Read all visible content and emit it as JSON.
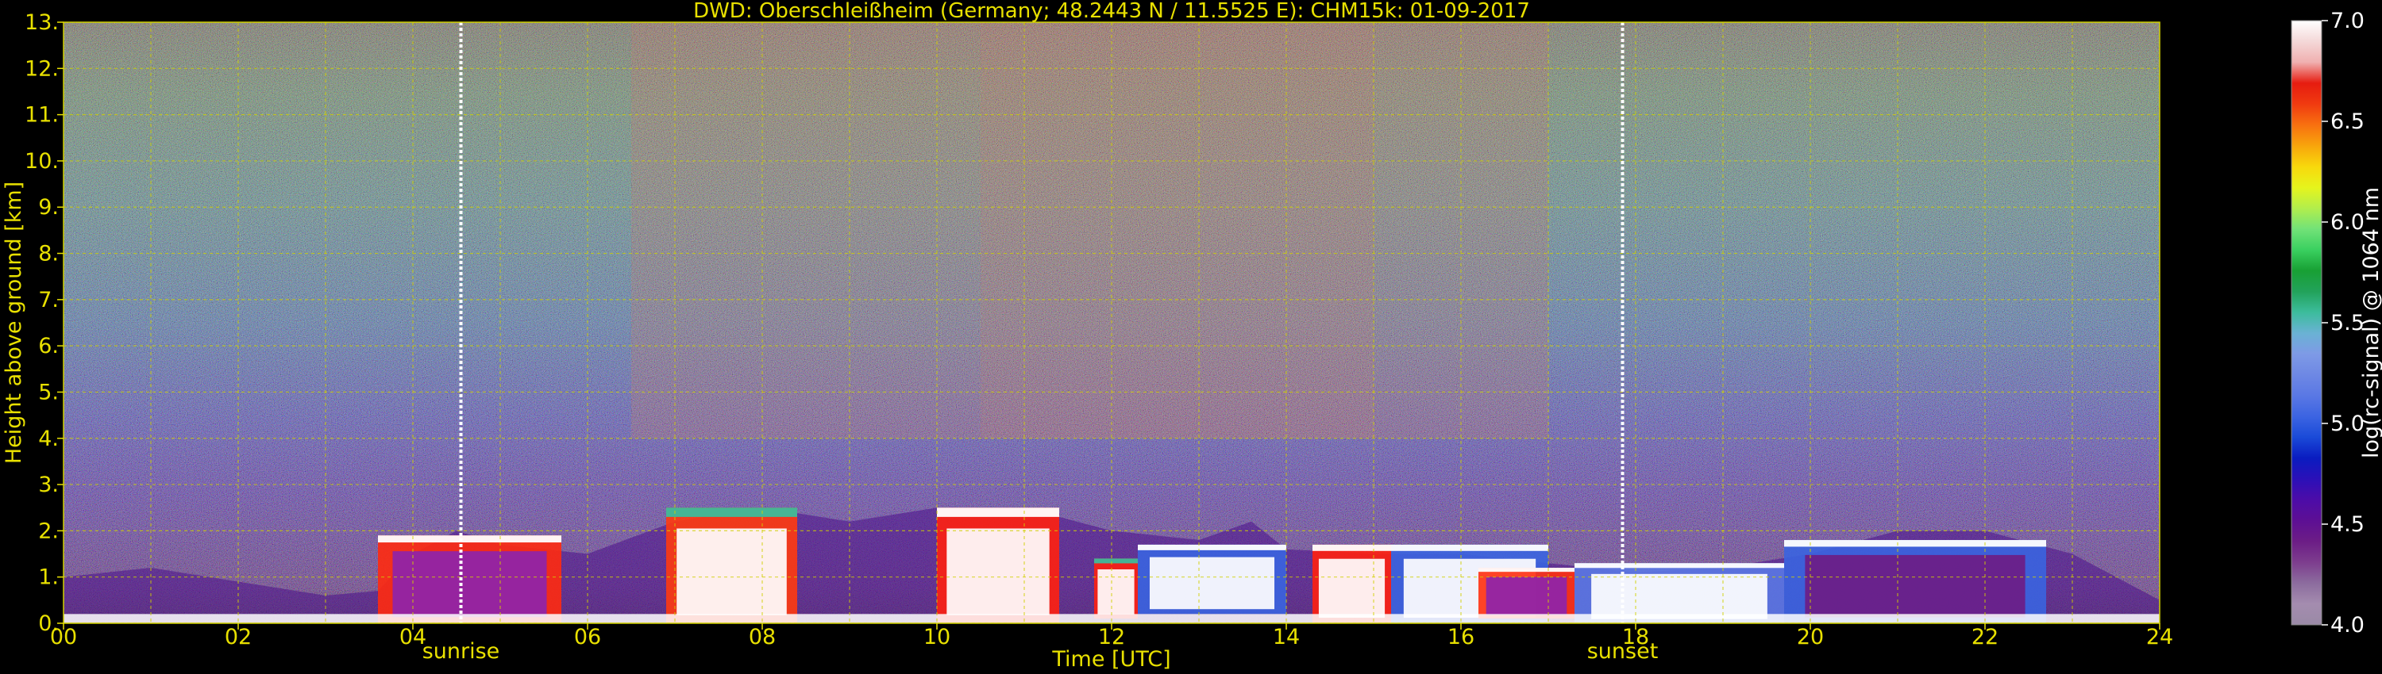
{
  "chart_data": {
    "type": "heatmap",
    "title": "DWD: Oberschleißheim (Germany; 48.2443 N / 11.5525 E):    CHM15k: 01-09-2017",
    "xlabel": "Time [UTC]",
    "ylabel": "Height above ground [km]",
    "xlim": [
      0,
      24
    ],
    "ylim": [
      0,
      13
    ],
    "x_ticks": [
      "00",
      "02",
      "04",
      "06",
      "08",
      "10",
      "12",
      "14",
      "16",
      "18",
      "20",
      "22",
      "24"
    ],
    "y_ticks": [
      "0.",
      "1.",
      "2.",
      "3.",
      "4.",
      "5.",
      "6.",
      "7.",
      "8.",
      "9.",
      "10.",
      "11.",
      "12.",
      "13."
    ],
    "grid": true,
    "colorbar": {
      "label": "log(rc-signal) @ 1064 nm",
      "range": [
        4.0,
        7.0
      ],
      "ticks": [
        "4.0",
        "4.5",
        "5.0",
        "5.5",
        "6.0",
        "6.5",
        "7.0"
      ],
      "colors": [
        "#9a8aa6",
        "#a48caf",
        "#8c6c9e",
        "#7d3d8e",
        "#6c1d86",
        "#5d0f94",
        "#4c0ca8",
        "#2b10b8",
        "#0a1cc0",
        "#1a4ad8",
        "#3c64e2",
        "#5a78e4",
        "#6e88e4",
        "#7e9ae6",
        "#6ab2d4",
        "#3cbc9c",
        "#22a25a",
        "#18a034",
        "#3ad060",
        "#72e278",
        "#b2ee4c",
        "#e6f41c",
        "#f8d80c",
        "#f8a40c",
        "#f87010",
        "#f03a10",
        "#e61c10",
        "#f0b0b0",
        "#f4d8d8",
        "#ffffff"
      ]
    },
    "events": [
      {
        "label": "sunrise",
        "time": 4.55
      },
      {
        "label": "sunset",
        "time": 17.85
      }
    ],
    "colors": {
      "text": "#e8e000",
      "background": "#000000",
      "grid": "#d0d000",
      "event_line": "#ffffff"
    },
    "boundary_layer": [
      [
        0,
        1.0
      ],
      [
        1.0,
        1.2
      ],
      [
        2.0,
        0.9
      ],
      [
        3.0,
        0.6
      ],
      [
        3.6,
        0.7
      ],
      [
        4.0,
        1.5
      ],
      [
        4.5,
        2.0
      ],
      [
        5.0,
        1.7
      ],
      [
        6.0,
        1.5
      ],
      [
        7.0,
        2.2
      ],
      [
        8.0,
        2.5
      ],
      [
        9.0,
        2.2
      ],
      [
        10.0,
        2.5
      ],
      [
        11.0,
        2.5
      ],
      [
        12.0,
        2.0
      ],
      [
        13.0,
        1.8
      ],
      [
        13.6,
        2.2
      ],
      [
        14.0,
        1.6
      ],
      [
        15.0,
        1.5
      ],
      [
        16.0,
        1.5
      ],
      [
        17.0,
        1.3
      ],
      [
        18.0,
        1.1
      ],
      [
        19.0,
        1.2
      ],
      [
        20.0,
        1.5
      ],
      [
        21.0,
        2.0
      ],
      [
        22.0,
        2.0
      ],
      [
        23.0,
        1.5
      ],
      [
        24.0,
        0.5
      ]
    ],
    "aerosol_blocks": [
      {
        "t0": 3.6,
        "t1": 5.7,
        "z0": 0.0,
        "z1": 1.9,
        "core": "#8e24aa",
        "edge": "#ff2a10",
        "top": "#ffffff"
      },
      {
        "t0": 6.9,
        "t1": 8.4,
        "z0": 0.0,
        "z1": 2.5,
        "core": "#ffffff",
        "edge": "#ff3a10",
        "top": "#3cbc9c"
      },
      {
        "t0": 10.0,
        "t1": 11.4,
        "z0": 0.0,
        "z1": 2.5,
        "core": "#ffffff",
        "edge": "#ff2010",
        "top": "#ffffff"
      },
      {
        "t0": 11.8,
        "t1": 12.3,
        "z0": 0.1,
        "z1": 1.4,
        "core": "#ffffff",
        "edge": "#ff2010",
        "top": "#3cbc9c"
      },
      {
        "t0": 12.3,
        "t1": 14.0,
        "z0": 0.2,
        "z1": 1.7,
        "core": "#ffffff",
        "edge": "#3a64e0",
        "top": "#ffffff"
      },
      {
        "t0": 14.3,
        "t1": 15.2,
        "z0": 0.0,
        "z1": 1.7,
        "core": "#ffffff",
        "edge": "#ff2010",
        "top": "#ffffff"
      },
      {
        "t0": 15.2,
        "t1": 17.0,
        "z0": 0.0,
        "z1": 1.7,
        "core": "#ffffff",
        "edge": "#3a64e0",
        "top": "#ffffff"
      },
      {
        "t0": 16.2,
        "t1": 17.3,
        "z0": 0.1,
        "z1": 1.2,
        "core": "#8e24aa",
        "edge": "#ff3010",
        "top": "#ffffff"
      },
      {
        "t0": 17.3,
        "t1": 19.7,
        "z0": 0.0,
        "z1": 1.3,
        "core": "#ffffff",
        "edge": "#5a78e4",
        "top": "#ffffff"
      },
      {
        "t0": 19.7,
        "t1": 22.7,
        "z0": 0.0,
        "z1": 1.8,
        "core": "#6c1d86",
        "edge": "#3a64e0",
        "top": "#ffffff"
      }
    ]
  }
}
